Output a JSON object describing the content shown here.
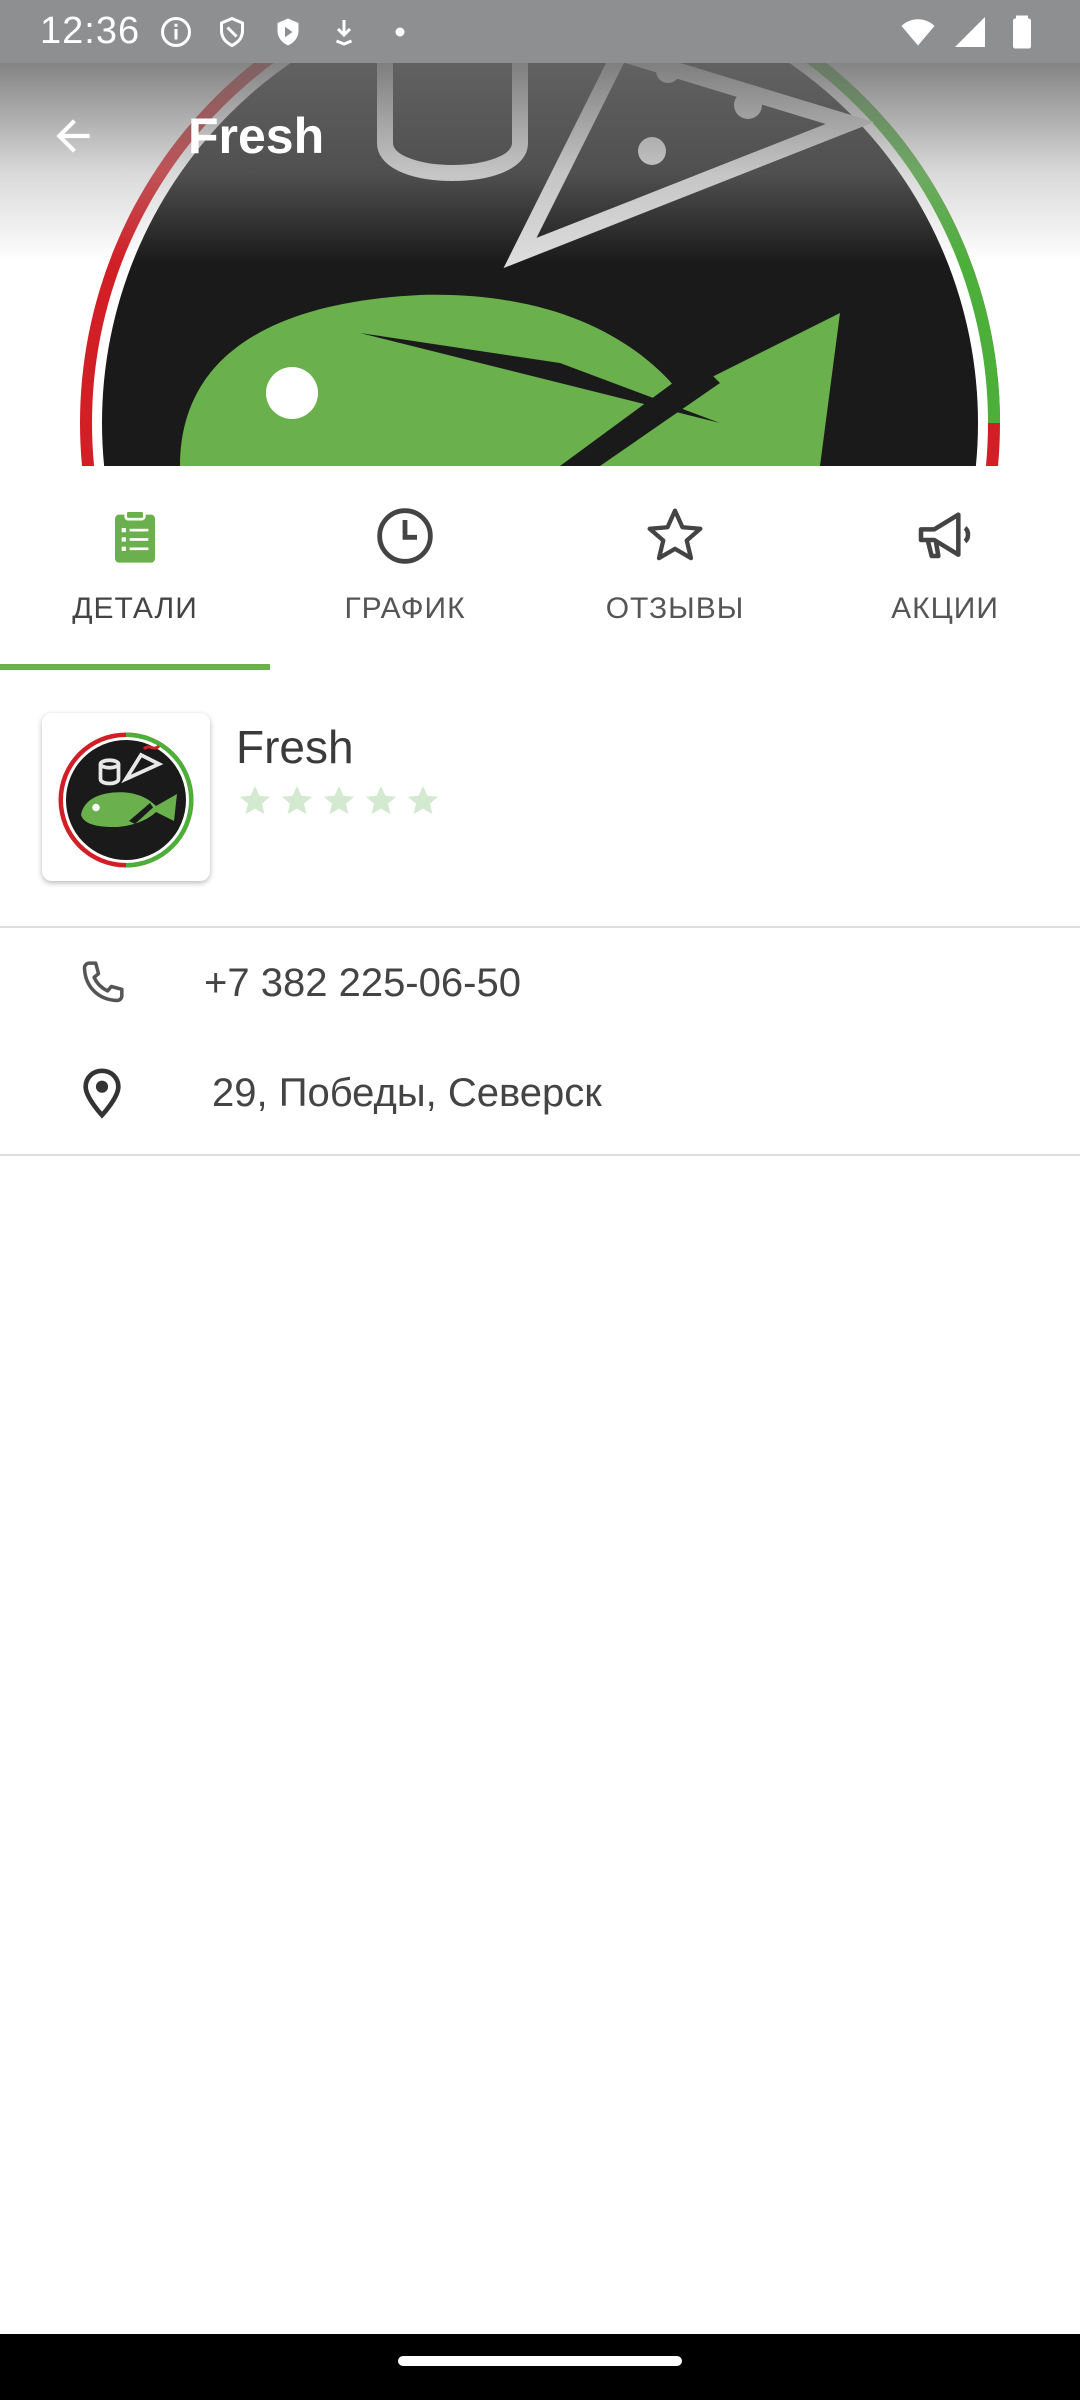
{
  "status_bar": {
    "time": "12:36",
    "left_icons": [
      "info-icon",
      "shield-icon",
      "play-protect-icon",
      "download-icon",
      "dot-icon"
    ],
    "right_icons": [
      "wifi-icon",
      "signal-icon",
      "battery-icon"
    ]
  },
  "app_bar": {
    "title": "Fresh",
    "back_icon": "arrow-back-icon"
  },
  "tabs": [
    {
      "label": "ДЕТАЛИ",
      "icon": "clipboard-icon",
      "active": true
    },
    {
      "label": "ГРАФИК",
      "icon": "clock-icon",
      "active": false
    },
    {
      "label": "ОТЗЫВЫ",
      "icon": "star-icon",
      "active": false
    },
    {
      "label": "АКЦИИ",
      "icon": "megaphone-icon",
      "active": false
    }
  ],
  "shop": {
    "name": "Fresh",
    "rating": 0,
    "rating_max": 5
  },
  "contacts": {
    "phone": "+7 382 225-06-50",
    "address": "29, Победы, Северск"
  },
  "colors": {
    "accent": "#6ab04c",
    "status_bar": "#8e8f91",
    "star_empty": "#d3ead0",
    "logo_black": "#1a1a1a",
    "logo_red": "#d21f26"
  }
}
